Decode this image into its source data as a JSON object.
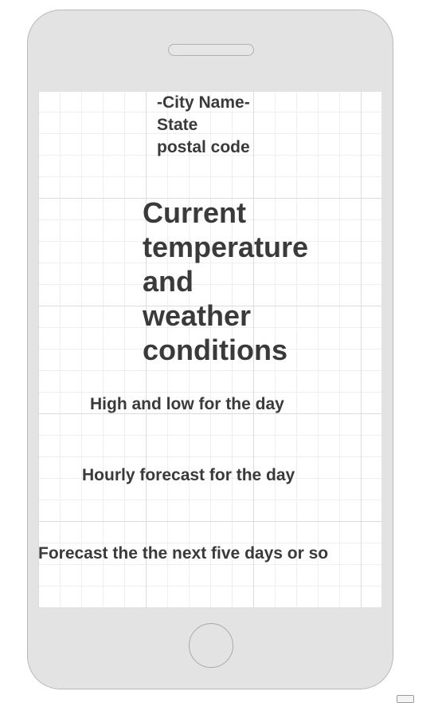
{
  "header": {
    "city": "-City Name-",
    "state": "State",
    "postal": "postal code"
  },
  "current": {
    "line1": "Current",
    "line2": "temperature",
    "line3": "and",
    "line4": "weather",
    "line5": "conditions"
  },
  "sections": {
    "high_low": "High and low for the day",
    "hourly": "Hourly forecast for the day",
    "five_day": "Forecast the the next five days or so"
  },
  "colors": {
    "text": "#3a3a3a",
    "phone_body": "#e3e3e3",
    "grid_major": "#dcdcdc",
    "grid_minor": "#efefef"
  },
  "icons": {
    "speaker": "speaker-grille",
    "home": "home-button"
  }
}
